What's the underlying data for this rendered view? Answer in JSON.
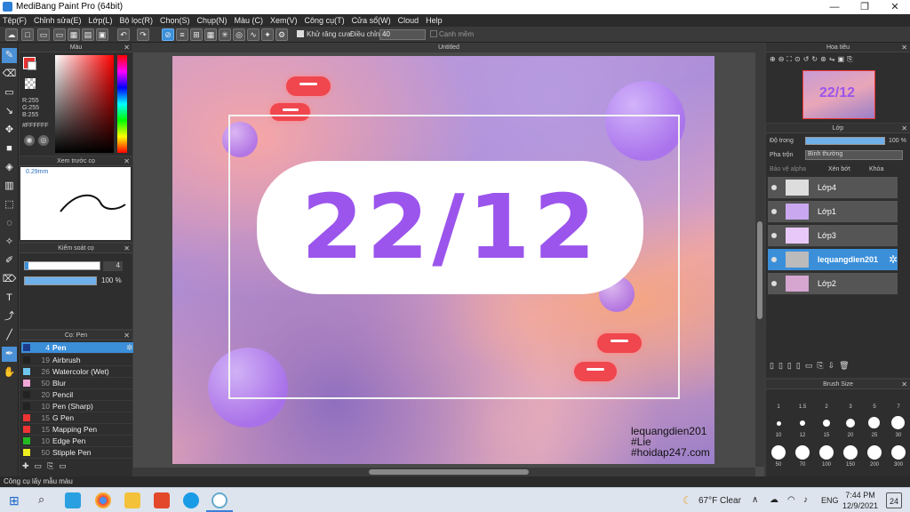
{
  "window": {
    "title": "MediBang Paint Pro (64bit)",
    "min": "—",
    "max": "❐",
    "close": "✕"
  },
  "menu": [
    "Tệp(F)",
    "Chỉnh sửa(E)",
    "Lớp(L)",
    "Bộ lọc(R)",
    "Chọn(S)",
    "Chụp(N)",
    "Màu (C)",
    "Xem(V)",
    "Công cụ(T)",
    "Cửa sổ(W)",
    "Cloud",
    "Help"
  ],
  "toolbar": {
    "antialias_label": "Khử răng cưa",
    "adjust_label": "Điều chỉnh",
    "adjust_value": "40",
    "smooth_label": "Cạnh mềm"
  },
  "color_panel": {
    "title": "Màu",
    "r": "R:255",
    "g": "G:255",
    "b": "B:255",
    "hex": "#FFFFFF"
  },
  "brush_preview": {
    "title": "Xem trước cọ",
    "size": "0.29mm"
  },
  "brush_control": {
    "title": "Kiểm soát cọ",
    "size": "4",
    "opacity": "100 %"
  },
  "brush_list": {
    "title": "Cọ: Pen",
    "items": [
      {
        "n": "4",
        "label": "Pen",
        "color": "#1e3a8a"
      },
      {
        "n": "19",
        "label": "Airbrush",
        "color": "#222"
      },
      {
        "n": "26",
        "label": "Watercolor (Wet)",
        "color": "#6ec6f0"
      },
      {
        "n": "50",
        "label": "Blur",
        "color": "#f0a8d8"
      },
      {
        "n": "20",
        "label": "Pencil",
        "color": "#222"
      },
      {
        "n": "10",
        "label": "Pen (Sharp)",
        "color": "#222"
      },
      {
        "n": "15",
        "label": "G Pen",
        "color": "#e33"
      },
      {
        "n": "15",
        "label": "Mapping Pen",
        "color": "#e33"
      },
      {
        "n": "10",
        "label": "Edge Pen",
        "color": "#2b2"
      },
      {
        "n": "50",
        "label": "Stipple Pen",
        "color": "#ee2"
      }
    ]
  },
  "canvas": {
    "tab": "Untitled",
    "art_text": "22/12",
    "watermark": [
      "lequangdien201",
      "#Lie",
      "#hoidap247.com"
    ]
  },
  "navigator": {
    "title": "Hoa tiêu"
  },
  "layer_panel": {
    "title": "Lớp",
    "opacity_label": "Độ trong",
    "opacity_value": "100 %",
    "blend_label": "Pha trộn",
    "blend_value": "Bình thường",
    "protect_alpha": "Bảo vệ alpha",
    "clip": "Xén bớt",
    "lock": "Khóa",
    "layers": [
      "Lớp4",
      "Lớp1",
      "Lớp3",
      "lequangdien201",
      "Lớp2"
    ]
  },
  "brush_size": {
    "title": "Brush Size",
    "labels": [
      "1",
      "1.5",
      "2",
      "3",
      "5",
      "7",
      "10",
      "12",
      "15",
      "20",
      "25",
      "30",
      "50",
      "70",
      "100",
      "150",
      "200",
      "300"
    ]
  },
  "status": "Công cụ lấy mẫu màu",
  "taskbar": {
    "weather": "67°F  Clear",
    "lang": "ENG",
    "time": "7:44 PM",
    "date": "12/9/2021",
    "notif": "24"
  }
}
